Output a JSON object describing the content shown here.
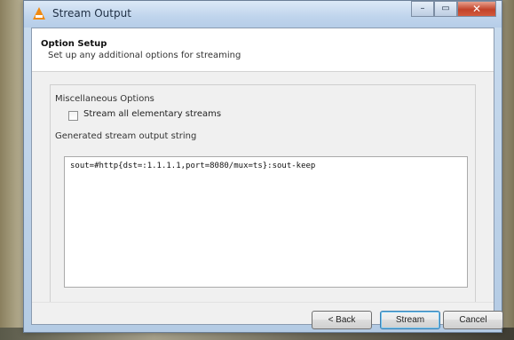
{
  "window": {
    "title": "Stream Output",
    "caption": {
      "minimize": "–",
      "maximize": "▭",
      "close": "✕"
    }
  },
  "header": {
    "title": "Option Setup",
    "subtitle": "Set up any additional options for streaming"
  },
  "misc": {
    "label": "Miscellaneous Options",
    "stream_all_label": "Stream all elementary streams",
    "stream_all_checked": false
  },
  "output": {
    "label": "Generated stream output string",
    "value": "sout=#http{dst=:1.1.1.1,port=8080/mux=ts}:sout-keep"
  },
  "buttons": {
    "back": "< Back",
    "stream": "Stream",
    "cancel": "Cancel"
  },
  "colors": {
    "accent": "#3c7fb1",
    "close_button": "#c2432a",
    "icon": "#f08a12"
  },
  "icons": {
    "app": "vlc-cone-icon",
    "check": "checkbox-icon"
  }
}
